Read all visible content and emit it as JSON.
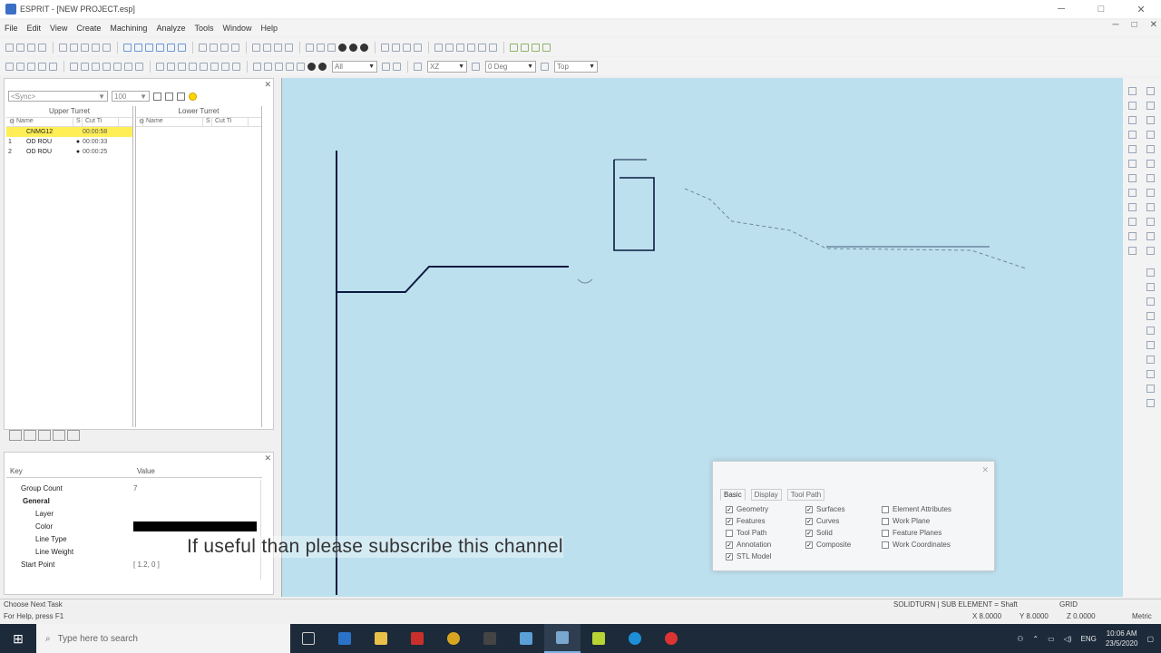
{
  "window": {
    "title": "ESPRIT - [NEW PROJECT.esp]",
    "minimize_glyph": "─",
    "maximize_glyph": "□",
    "close_glyph": "✕"
  },
  "menu": [
    "File",
    "Edit",
    "View",
    "Create",
    "Machining",
    "Analyze",
    "Tools",
    "Window",
    "Help"
  ],
  "toolbar": {
    "layer_combo": "All",
    "zoom_combo": "XZ",
    "view_combo": "0 Deg",
    "plane_combo": "Top"
  },
  "project_manager": {
    "filter_combo": "<Sync>",
    "group_combo": "100",
    "upper_title": "Upper Turret",
    "lower_title": "Lower Turret",
    "headers": [
      "Name",
      "S",
      "Cut Ti"
    ],
    "rows": [
      {
        "num": "",
        "name": "CNMG12",
        "status": "",
        "time": "00:00:58",
        "selected": true
      },
      {
        "num": "1",
        "name": "OD ROU",
        "status": "●",
        "time": "00:00:33",
        "selected": false
      },
      {
        "num": "2",
        "name": "OD ROU",
        "status": "●",
        "time": "00:00:25",
        "selected": false
      }
    ]
  },
  "properties": {
    "headers": [
      "Key",
      "Value"
    ],
    "rows": [
      {
        "key": "Group Count",
        "value": "7",
        "section": false
      },
      {
        "key": "General",
        "value": "",
        "section": true
      },
      {
        "key": "Layer",
        "value": "",
        "section": false
      },
      {
        "key": "Color",
        "value": "",
        "section": false,
        "swatch": "#000000"
      },
      {
        "key": "Line Type",
        "value": "",
        "section": false
      },
      {
        "key": "Line Weight",
        "value": "",
        "section": false
      },
      {
        "key": "Start Point",
        "value": "[ 1.2, 0 ]",
        "section": false
      }
    ]
  },
  "view_dialog": {
    "tabs": [
      "Basic",
      "Display",
      "Tool Path"
    ],
    "checks": [
      {
        "label": "Geometry",
        "checked": true
      },
      {
        "label": "Features",
        "checked": true
      },
      {
        "label": "Tool Path",
        "checked": false
      },
      {
        "label": "Annotation",
        "checked": true
      },
      {
        "label": "STL Model",
        "checked": true
      },
      {
        "label": "Surfaces",
        "checked": true
      },
      {
        "label": "Curves",
        "checked": true
      },
      {
        "label": "Solid",
        "checked": true
      },
      {
        "label": "Composite",
        "checked": true
      },
      {
        "label": "Element Attributes",
        "checked": false
      },
      {
        "label": "Work Plane",
        "checked": false
      },
      {
        "label": "Feature Planes",
        "checked": false
      },
      {
        "label": "Work Coordinates",
        "checked": false
      }
    ]
  },
  "subtitle": "If useful than please subscribe this channel",
  "status": {
    "prompt": "Choose Next Task",
    "help": "For Help, press F1",
    "selection": "SOLIDTURN | SUB ELEMENT = Shaft",
    "grid": "GRID",
    "x": "X 8.0000",
    "y": "Y 8.0000",
    "z": "Z 0.0000",
    "units": "Metric"
  },
  "taskbar": {
    "search_placeholder": "Type here to search",
    "lang": "ENG",
    "time": "10:06 AM",
    "date": "23/5/2020"
  },
  "colors": {
    "viewport_bg": "#bde0ee",
    "highlight": "#ffee55",
    "taskbar": "#1c2a3a"
  }
}
